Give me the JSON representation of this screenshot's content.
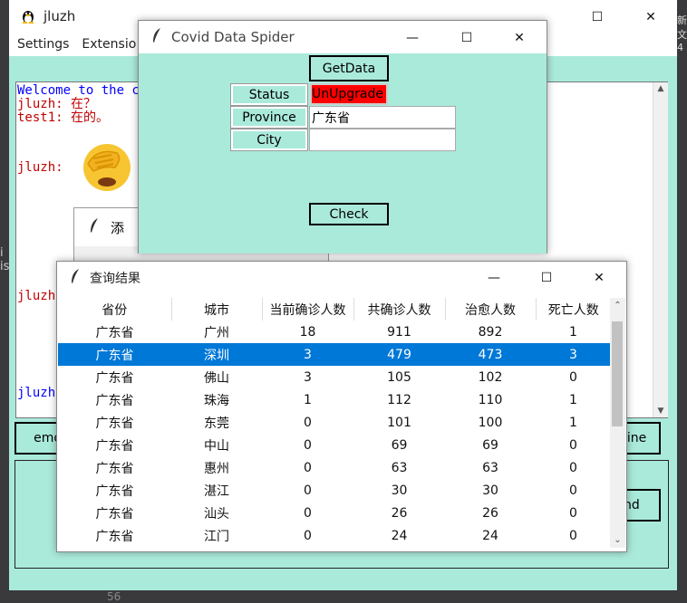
{
  "main_window": {
    "title": "jluzh",
    "menu": [
      "Settings",
      "Extensio"
    ],
    "chat_lines": [
      {
        "text": "Welcome to the c",
        "color": "#0000ff"
      },
      {
        "text": "jluzh: 在？",
        "color": "#c00000"
      },
      {
        "text": "test1: 在的。",
        "color": "#c00000"
      }
    ],
    "chat_sender_3": "jluzh:",
    "chat_sender_4": "jluzh",
    "chat_sender_5": "jluzh",
    "emoji_panel_label": "添",
    "left_button_label": "emo",
    "right_button_1_label": "line",
    "right_button_2_label": "nd",
    "edge_text_1": "i",
    "edge_text_2": "is",
    "editor_line_number": "56",
    "edge_right_top": "新",
    "edge_right_bottom": "文4"
  },
  "spider_window": {
    "title": "Covid Data Spider",
    "getdata_label": "GetData",
    "status_label": "Status",
    "status_value": "UnUpgrade",
    "status_color": "#ff0000",
    "province_label": "Province",
    "province_value": "广东省",
    "city_label": "City",
    "city_value": "",
    "check_label": "Check"
  },
  "result_window": {
    "title": "查询结果",
    "columns": [
      "省份",
      "城市",
      "当前确诊人数",
      "共确诊人数",
      "治愈人数",
      "死亡人数"
    ],
    "rows": [
      [
        "广东省",
        "广州",
        "18",
        "911",
        "892",
        "1"
      ],
      [
        "广东省",
        "深圳",
        "3",
        "479",
        "473",
        "3"
      ],
      [
        "广东省",
        "佛山",
        "3",
        "105",
        "102",
        "0"
      ],
      [
        "广东省",
        "珠海",
        "1",
        "112",
        "110",
        "1"
      ],
      [
        "广东省",
        "东莞",
        "0",
        "101",
        "100",
        "1"
      ],
      [
        "广东省",
        "中山",
        "0",
        "69",
        "69",
        "0"
      ],
      [
        "广东省",
        "惠州",
        "0",
        "63",
        "63",
        "0"
      ],
      [
        "广东省",
        "湛江",
        "0",
        "30",
        "30",
        "0"
      ],
      [
        "广东省",
        "汕头",
        "0",
        "26",
        "26",
        "0"
      ],
      [
        "广东省",
        "江门",
        "0",
        "24",
        "24",
        "0"
      ]
    ],
    "selected_row": 1,
    "accent": "#0078d7"
  },
  "icons": {
    "app": "penguin-icon",
    "tk": "feather-icon",
    "emoji": "facepalm-emoji-icon"
  }
}
